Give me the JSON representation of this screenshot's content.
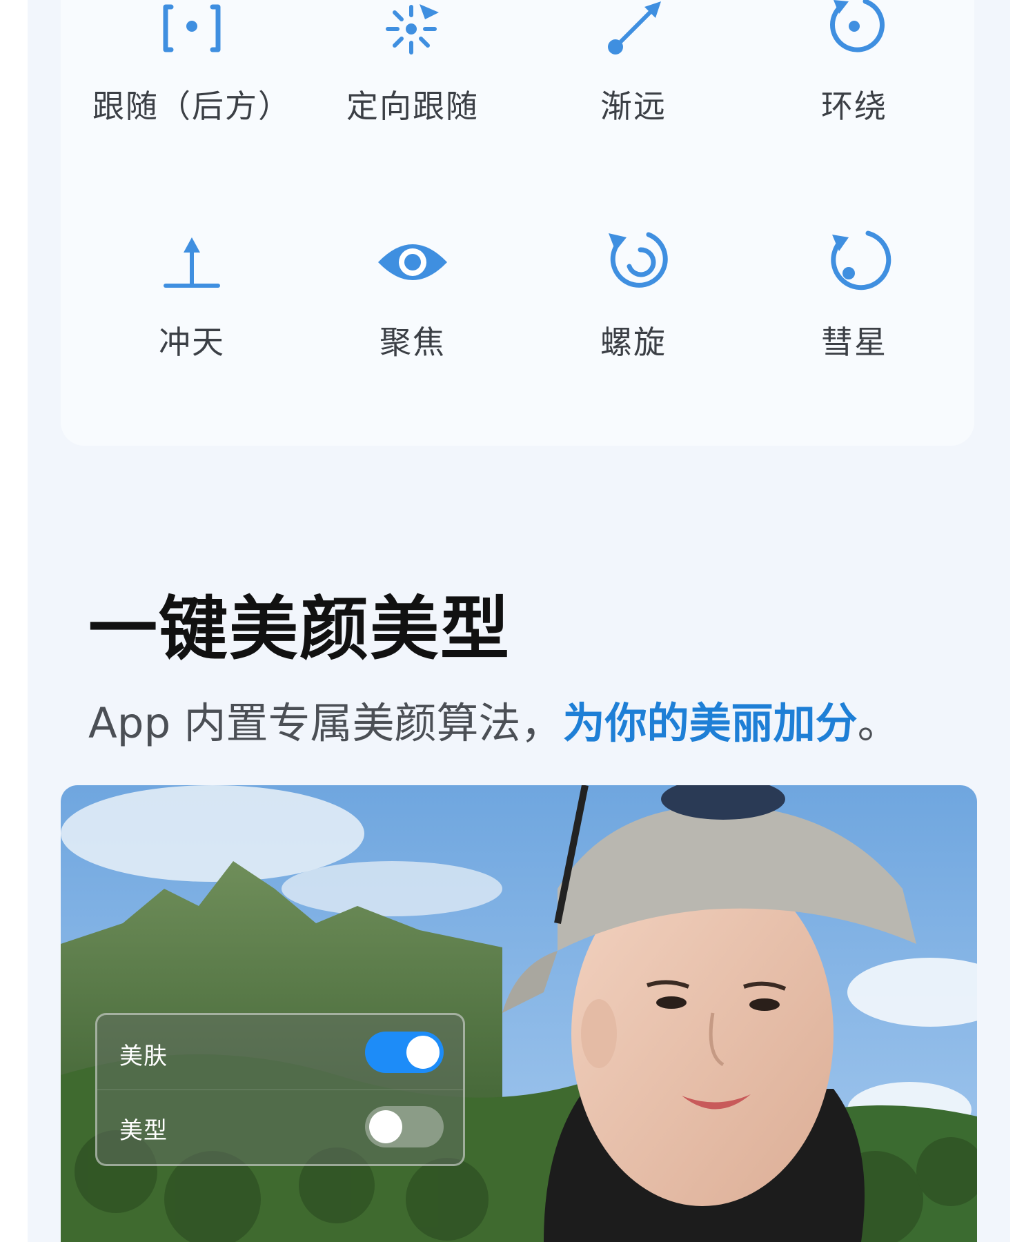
{
  "colors": {
    "accent": "#1e7fd6",
    "icon": "#3f8fe0",
    "toggle_on": "#1d8cf8"
  },
  "modes": [
    {
      "label": "跟随（后方）",
      "icon": "follow-rear-icon"
    },
    {
      "label": "定向跟随",
      "icon": "directional-follow-icon"
    },
    {
      "label": "渐远",
      "icon": "dronie-icon"
    },
    {
      "label": "环绕",
      "icon": "orbit-icon"
    },
    {
      "label": "冲天",
      "icon": "rocket-icon"
    },
    {
      "label": "聚焦",
      "icon": "spotlight-eye-icon"
    },
    {
      "label": "螺旋",
      "icon": "helix-icon"
    },
    {
      "label": "彗星",
      "icon": "comet-icon"
    }
  ],
  "section": {
    "title": "一键美颜美型",
    "subtitle_plain": "App 内置专属美颜算法，",
    "subtitle_highlight": "为你的美丽加分",
    "subtitle_end": "。"
  },
  "beauty_panel": {
    "rows": [
      {
        "label": "美肤",
        "enabled": true
      },
      {
        "label": "美型",
        "enabled": false
      }
    ]
  }
}
